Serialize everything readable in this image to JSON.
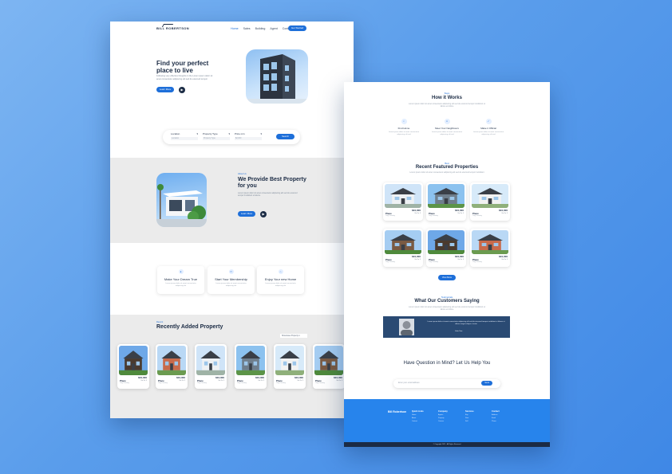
{
  "left_page": {
    "logo": "BILL ROBERTSON",
    "nav": [
      "Home",
      "Sales",
      "Building",
      "Agent",
      "Contact Us"
    ],
    "nav_button": "Get Started",
    "hero": {
      "title": "Find your perfect place to live",
      "text": "Following very effective thoughts in the Lorem ipsum dolor sit amet consectetur adipiscing elit sed do eiusmod tempor",
      "button": "Learn More",
      "play": "▶"
    },
    "search": {
      "fields": [
        {
          "label": "Location",
          "value": "Location"
        },
        {
          "label": "Property Type",
          "value": "Property Type"
        },
        {
          "label": "Price min",
          "value": "$2,000"
        }
      ],
      "button": "Search"
    },
    "about": {
      "kicker": "About Us",
      "title": "We Provide Best Property for you",
      "text": "Lorem ipsum dolor sit amet consectetur adipiscing elit sed do eiusmod tempor incididunt ut labore",
      "button": "Learn More"
    },
    "features": [
      {
        "icon": "person-icon",
        "title": "Make Your Dream True",
        "text": "Lorem ipsum dolor sit amet consectetur adipiscing elit"
      },
      {
        "icon": "card-icon",
        "title": "Start Your Membership",
        "text": "Lorem ipsum dolor sit amet consectetur adipiscing elit"
      },
      {
        "icon": "home-icon",
        "title": "Enjoy Your new Home",
        "text": "Lorem ipsum dolor sit amet consectetur adipiscing elit"
      }
    ],
    "recent": {
      "kicker": "Recent",
      "title": "Recently Added Property",
      "select": "Showcase Property"
    },
    "recent_cards": [
      {
        "price": "$10,000",
        "name": "Place",
        "loc": "City,Country",
        "meta": "3 ▪ 2 ▪ 1"
      },
      {
        "price": "$10,000",
        "name": "Place",
        "loc": "City,Country",
        "meta": "3 ▪ 2 ▪ 1"
      },
      {
        "price": "$10,000",
        "name": "Place",
        "loc": "City,Country",
        "meta": "3 ▪ 2 ▪ 1"
      },
      {
        "price": "$10,000",
        "name": "Place",
        "loc": "City,Country",
        "meta": "3 ▪ 2 ▪ 1"
      },
      {
        "price": "$10,000",
        "name": "Place",
        "loc": "City,Country",
        "meta": "3 ▪ 2 ▪ 1"
      },
      {
        "price": "$10,000",
        "name": "Place",
        "loc": "City,Country",
        "meta": "3 ▪ 2 ▪ 1"
      }
    ]
  },
  "right_page": {
    "how": {
      "kicker": "Steps",
      "title": "How it Works",
      "text": "Lorem ipsum dolor sit amet consectetur adipiscing elit sed do eiusmod tempor incididunt ut labore et dolore"
    },
    "steps": [
      {
        "title": "Find Home",
        "text": "Lorem ipsum dolor sit amet consectetur adipiscing elit sed"
      },
      {
        "title": "Meet Your Neighbours",
        "text": "Lorem ipsum dolor sit amet consectetur adipiscing elit sed"
      },
      {
        "title": "Make it Official",
        "text": "Lorem ipsum dolor sit amet consectetur adipiscing elit sed"
      }
    ],
    "featured": {
      "kicker": "Best",
      "title": "Recent Featured Properties",
      "text": "Lorem ipsum dolor sit amet consectetur adipiscing elit sed do eiusmod tempor incididunt"
    },
    "featured_cards": [
      {
        "price": "$10,000",
        "name": "Place",
        "loc": "City,Country",
        "meta": "3 ▪ 2 ▪ 1"
      },
      {
        "price": "$10,000",
        "name": "Place",
        "loc": "City,Country",
        "meta": "3 ▪ 2 ▪ 1"
      },
      {
        "price": "$10,000",
        "name": "Place",
        "loc": "City,Country",
        "meta": "3 ▪ 2 ▪ 1"
      },
      {
        "price": "$10,000",
        "name": "Place",
        "loc": "City,Country",
        "meta": "3 ▪ 2 ▪ 1"
      },
      {
        "price": "$10,000",
        "name": "Place",
        "loc": "City,Country",
        "meta": "3 ▪ 2 ▪ 1"
      },
      {
        "price": "$10,000",
        "name": "Place",
        "loc": "City,Country",
        "meta": "3 ▪ 2 ▪ 1"
      }
    ],
    "view_all": "View More",
    "testimonials": {
      "kicker": "Testimonials",
      "title": "What Our Customers Saying",
      "text": "Lorem ipsum dolor sit amet consectetur adipiscing elit sed do eiusmod tempor incididunt ut labore et dolore",
      "quote": "Lorem ipsum dolor sit amet consectetur adipiscing elit sed do eiusmod tempor incididunt ut labore et dolore magna aliqua ut enim",
      "who": "John Doe"
    },
    "question": "Have Question in Mind? Let Us Help You",
    "subscribe": {
      "placeholder": "Enter your email address",
      "button": "Send"
    },
    "footer": {
      "brand": "Bill Robertson",
      "columns": [
        {
          "heading": "Quick Links",
          "links": [
            "Home",
            "About",
            "Contact"
          ]
        },
        {
          "heading": "Company",
          "links": [
            "Agents",
            "Property",
            "Careers"
          ]
        },
        {
          "heading": "Services",
          "links": [
            "Buy",
            "Rent",
            "Sell"
          ]
        },
        {
          "heading": "Contact",
          "links": [
            "Address",
            "Email",
            "Phone"
          ]
        }
      ],
      "copyright": "© Copyright 2021 - All Rights Reserved"
    }
  }
}
